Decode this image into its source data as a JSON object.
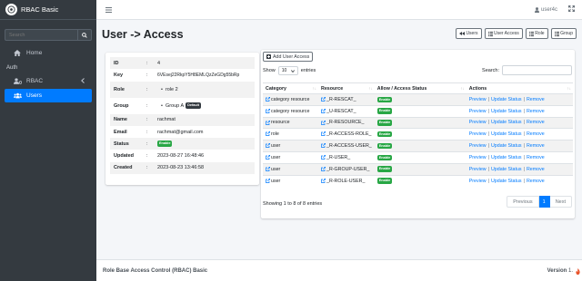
{
  "brand": {
    "name": "RBAC Basic"
  },
  "sidebar": {
    "search_placeholder": "Search",
    "items": [
      {
        "label": "Home",
        "icon": "home-icon"
      },
      {
        "header": "Auth"
      },
      {
        "label": "RBAC",
        "icon": "users-cog-icon"
      },
      {
        "label": "Users",
        "icon": "users-icon",
        "active": true
      }
    ]
  },
  "topbar": {
    "user": "user4c"
  },
  "page": {
    "title": "User -> Access",
    "buttons": {
      "users": "Users",
      "user_access": "User Access",
      "role": "Role",
      "group": "Group"
    }
  },
  "details": {
    "id_label": "ID",
    "id_value": "4",
    "key_label": "Key",
    "key_value": "6VEsej22RkpY5H8EMLQzZeGDg55bRp",
    "role_label": "Role",
    "role_value": "role 2",
    "group_label": "Group",
    "group_value": "Group A",
    "group_badge": "Default",
    "name_label": "Name",
    "name_value": "rachmat",
    "email_label": "Email",
    "email_value": "rachmat@gmail.com",
    "status_label": "Status",
    "status_value": "Enable",
    "updated_label": "Updated",
    "updated_value": "2023-08-27 16:48:46",
    "created_label": "Created",
    "created_value": "2023-08-23 13:46:58",
    "colon": ":"
  },
  "access": {
    "add_button": "Add User Access",
    "show_label": "Show",
    "length": "10",
    "entries_label": "entries",
    "search_label": "Search:",
    "headers": {
      "category": "Category",
      "resource": "Resource",
      "status": "Allow / Access Status",
      "actions": "Actions"
    },
    "rows": [
      {
        "category": "category resource",
        "resource": "_R-RESCAT_",
        "status": "Enable"
      },
      {
        "category": "category resource",
        "resource": "_U-RESCAT_",
        "status": "Enable"
      },
      {
        "category": "resource",
        "resource": "_R-RESOURCE_",
        "status": "Enable"
      },
      {
        "category": "role",
        "resource": "_R-ACCESS-ROLE_",
        "status": "Enable"
      },
      {
        "category": "user",
        "resource": "_R-ACCESS-USER_",
        "status": "Enable"
      },
      {
        "category": "user",
        "resource": "_R-USER_",
        "status": "Enable"
      },
      {
        "category": "user",
        "resource": "_R-GROUP-USER_",
        "status": "Enable"
      },
      {
        "category": "user",
        "resource": "_R-ROLE-USER_",
        "status": "Enable"
      }
    ],
    "actions": {
      "preview": "Preview",
      "update": "Update Status",
      "remove": "Remove",
      "sep": "|"
    },
    "info": "Showing 1 to 8 of 8 entries",
    "pagination": {
      "previous": "Previous",
      "page": "1",
      "next": "Next"
    }
  },
  "footer": {
    "left": "Role Base Access Control (RBAC) Basic",
    "version_label": "Version",
    "version_value": "1."
  },
  "colors": {
    "primary": "#007bff",
    "success": "#28a745",
    "sidebar": "#343a40"
  }
}
